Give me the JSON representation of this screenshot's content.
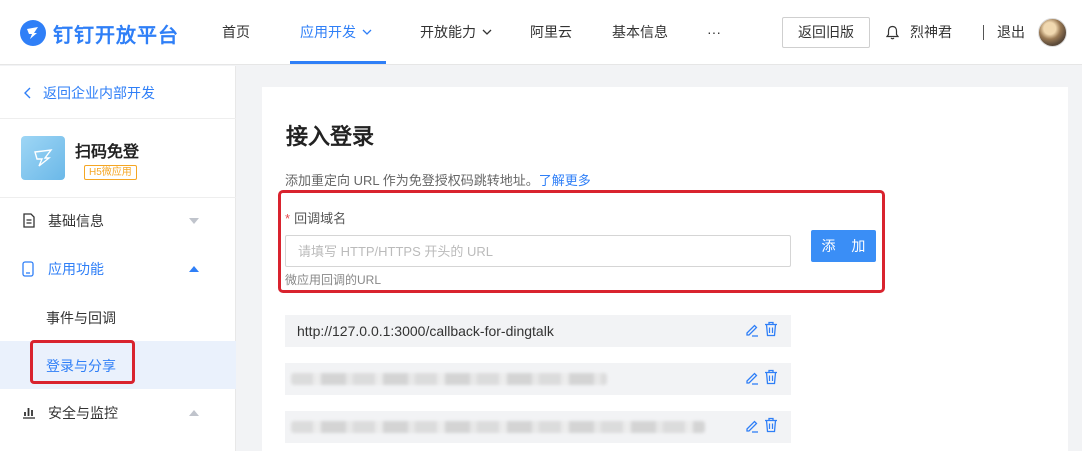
{
  "brand": {
    "name": "钉钉开放平台",
    "color": "#2f7ff7"
  },
  "nav": {
    "items": [
      {
        "label": "首页"
      },
      {
        "label": "应用开发",
        "active": true,
        "has_dropdown": true
      },
      {
        "label": "开放能力",
        "has_dropdown": true
      },
      {
        "label": "阿里云"
      },
      {
        "label": "基本信息"
      },
      {
        "label": "···"
      }
    ],
    "old_version_label": "返回旧版",
    "user_name": "烈神君",
    "logout_label": "退出"
  },
  "sidebar": {
    "back_label": "返回企业内部开发",
    "app": {
      "name": "扫码免登",
      "badge": "H5微应用"
    },
    "menu": [
      {
        "label": "基础信息",
        "icon": "document-icon",
        "expanded": false
      },
      {
        "label": "应用功能",
        "icon": "phone-icon",
        "expanded": true
      },
      {
        "label": "安全与监控",
        "icon": "chart-icon",
        "expanded": false
      }
    ],
    "submenu": [
      {
        "label": "事件与回调"
      },
      {
        "label": "登录与分享",
        "selected": true
      }
    ]
  },
  "main": {
    "title": "接入登录",
    "description": "添加重定向 URL 作为免登授权码跳转地址。",
    "learn_more": "了解更多",
    "field": {
      "label": "回调域名",
      "required": true,
      "placeholder": "请填写 HTTP/HTTPS 开头的 URL",
      "value": "",
      "hint": "微应用回调的URL"
    },
    "add_label": "添 加",
    "urls": [
      {
        "value": "http://127.0.0.1:3000/callback-for-dingtalk",
        "blurred": false
      },
      {
        "value": "",
        "blurred": true
      },
      {
        "value": "",
        "blurred": true
      }
    ]
  },
  "colors": {
    "accent": "#2f7ff7",
    "highlight_box": "#d9232e",
    "required_star": "#e5484d"
  }
}
